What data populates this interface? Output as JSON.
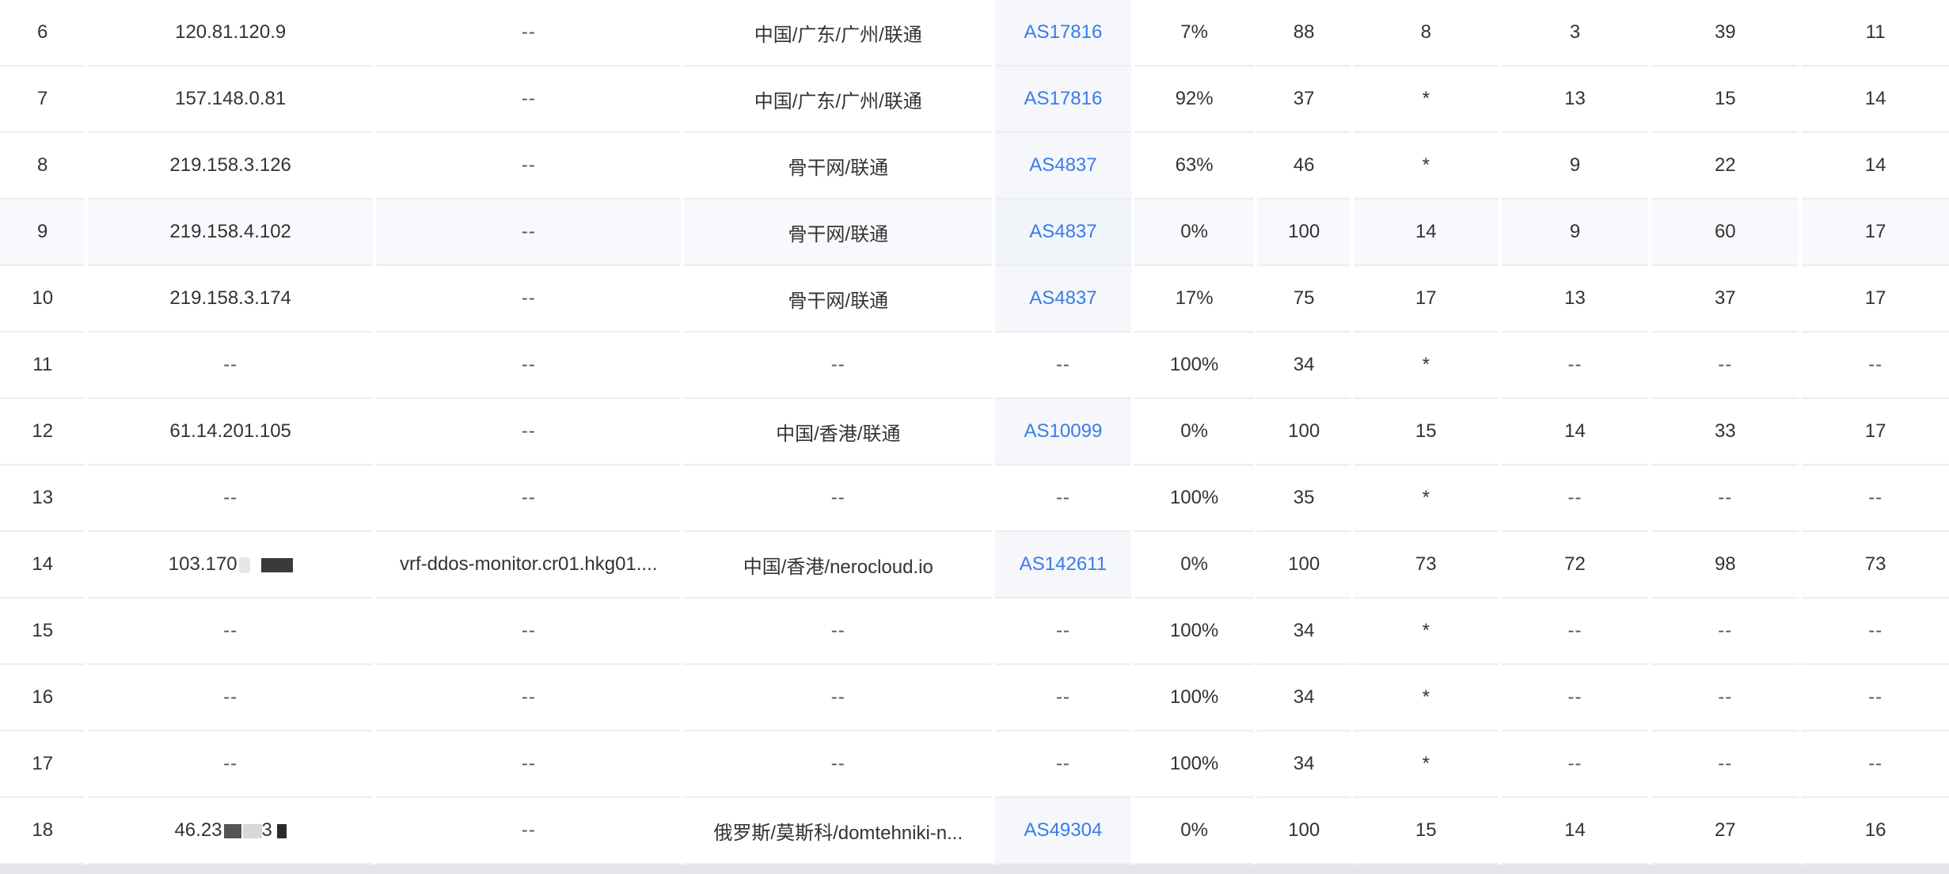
{
  "rows": [
    {
      "hop": "6",
      "ip": "120.81.120.9",
      "host": "--",
      "location": "中国/广东/广州/联通",
      "asn": "AS17816",
      "loss": "7%",
      "sent": "88",
      "last": "8",
      "best": "3",
      "worst": "39",
      "avg": "11"
    },
    {
      "hop": "7",
      "ip": "157.148.0.81",
      "host": "--",
      "location": "中国/广东/广州/联通",
      "asn": "AS17816",
      "loss": "92%",
      "sent": "37",
      "last": "*",
      "best": "13",
      "worst": "15",
      "avg": "14"
    },
    {
      "hop": "8",
      "ip": "219.158.3.126",
      "host": "--",
      "location": "骨干网/联通",
      "asn": "AS4837",
      "loss": "63%",
      "sent": "46",
      "last": "*",
      "best": "9",
      "worst": "22",
      "avg": "14"
    },
    {
      "hop": "9",
      "ip": "219.158.4.102",
      "host": "--",
      "location": "骨干网/联通",
      "asn": "AS4837",
      "loss": "0%",
      "sent": "100",
      "last": "14",
      "best": "9",
      "worst": "60",
      "avg": "17"
    },
    {
      "hop": "10",
      "ip": "219.158.3.174",
      "host": "--",
      "location": "骨干网/联通",
      "asn": "AS4837",
      "loss": "17%",
      "sent": "75",
      "last": "17",
      "best": "13",
      "worst": "37",
      "avg": "17"
    },
    {
      "hop": "11",
      "ip": "--",
      "host": "--",
      "location": "--",
      "asn": "--",
      "loss": "100%",
      "sent": "34",
      "last": "*",
      "best": "--",
      "worst": "--",
      "avg": "--"
    },
    {
      "hop": "12",
      "ip": "61.14.201.105",
      "host": "--",
      "location": "中国/香港/联通",
      "asn": "AS10099",
      "loss": "0%",
      "sent": "100",
      "last": "15",
      "best": "14",
      "worst": "33",
      "avg": "17"
    },
    {
      "hop": "13",
      "ip": "--",
      "host": "--",
      "location": "--",
      "asn": "--",
      "loss": "100%",
      "sent": "35",
      "last": "*",
      "best": "--",
      "worst": "--",
      "avg": "--"
    },
    {
      "hop": "14",
      "ip": "103.170",
      "host": "vrf-ddos-monitor.cr01.hkg01....",
      "location": "中国/香港/nerocloud.io",
      "asn": "AS142611",
      "loss": "0%",
      "sent": "100",
      "last": "73",
      "best": "72",
      "worst": "98",
      "avg": "73"
    },
    {
      "hop": "15",
      "ip": "--",
      "host": "--",
      "location": "--",
      "asn": "--",
      "loss": "100%",
      "sent": "34",
      "last": "*",
      "best": "--",
      "worst": "--",
      "avg": "--"
    },
    {
      "hop": "16",
      "ip": "--",
      "host": "--",
      "location": "--",
      "asn": "--",
      "loss": "100%",
      "sent": "34",
      "last": "*",
      "best": "--",
      "worst": "--",
      "avg": "--"
    },
    {
      "hop": "17",
      "ip": "--",
      "host": "--",
      "location": "--",
      "asn": "--",
      "loss": "100%",
      "sent": "34",
      "last": "*",
      "best": "--",
      "worst": "--",
      "avg": "--"
    },
    {
      "hop": "18",
      "ip": "46.23",
      "ip_tail": "3",
      "host": "--",
      "location": "俄罗斯/莫斯科/domtehniki-n...",
      "asn": "AS49304",
      "loss": "0%",
      "sent": "100",
      "last": "15",
      "best": "14",
      "worst": "27",
      "avg": "16"
    }
  ],
  "colors": {
    "link": "#3a7be8",
    "text": "#333333",
    "border": "#ebedf0",
    "asn_column_bg": "#f5f7fa",
    "hover_row_bg": "#f7f9fd",
    "scrollbar": "#e3e5e8"
  }
}
